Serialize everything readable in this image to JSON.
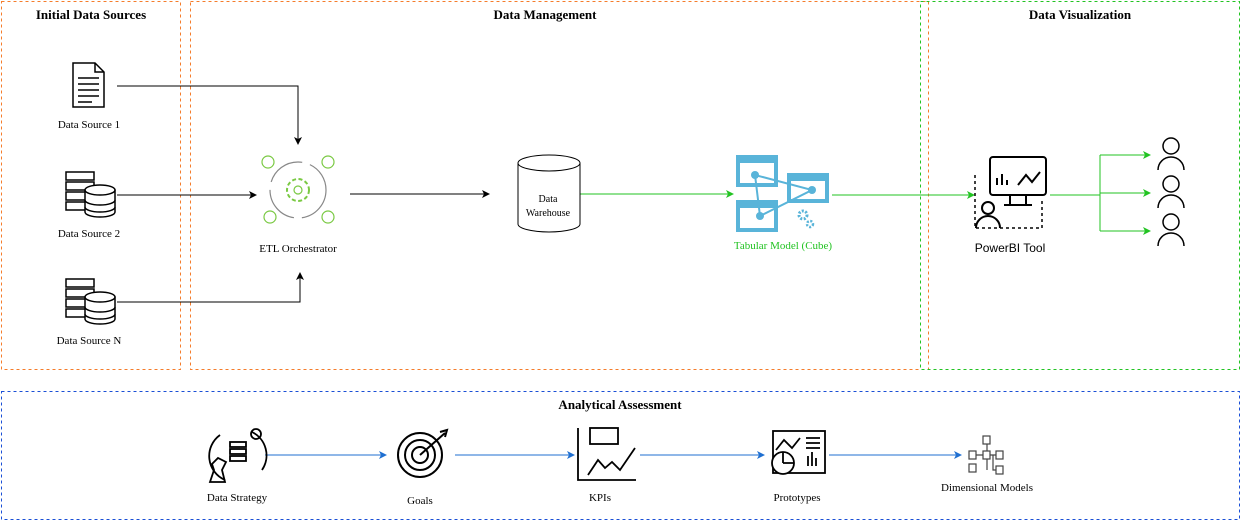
{
  "colors": {
    "orange": "#f57c2b",
    "green": "#22c322",
    "blue": "#1a4fd6",
    "arrow_blue": "#1f6fd1",
    "cube_blue": "#59b4d9",
    "etl_green": "#7ac943"
  },
  "groups": {
    "initial_sources": {
      "title": "Initial Data Sources"
    },
    "data_management": {
      "title": "Data Management"
    },
    "data_visualization": {
      "title": "Data Visualization"
    },
    "analytical_assessment": {
      "title": "Analytical Assessment"
    }
  },
  "nodes": {
    "source1": {
      "label": "Data Source 1",
      "icon": "document-icon"
    },
    "source2": {
      "label": "Data Source 2",
      "icon": "server-database-icon"
    },
    "sourceN": {
      "label": "Data Source N",
      "icon": "server-database-icon"
    },
    "etl": {
      "label": "ETL Orchestrator",
      "icon": "gear-cycle-icon"
    },
    "warehouse": {
      "label_line1": "Data",
      "label_line2": "Warehouse",
      "icon": "cylinder"
    },
    "tabular": {
      "label": "Tabular Model (Cube)",
      "icon": "analysis-services-icon"
    },
    "powerbi": {
      "label": "PowerBI Tool",
      "icon": "dashboard-user-icon"
    },
    "users": {
      "icon": "user-icon"
    }
  },
  "assessment": [
    {
      "label": "Data Strategy",
      "icon": "strategy-icon"
    },
    {
      "label": "Goals",
      "icon": "target-icon"
    },
    {
      "label": "KPIs",
      "icon": "kpi-chart-icon"
    },
    {
      "label": "Prototypes",
      "icon": "dashboard-icon"
    },
    {
      "label": "Dimensional Models",
      "icon": "hierarchy-icon"
    }
  ]
}
